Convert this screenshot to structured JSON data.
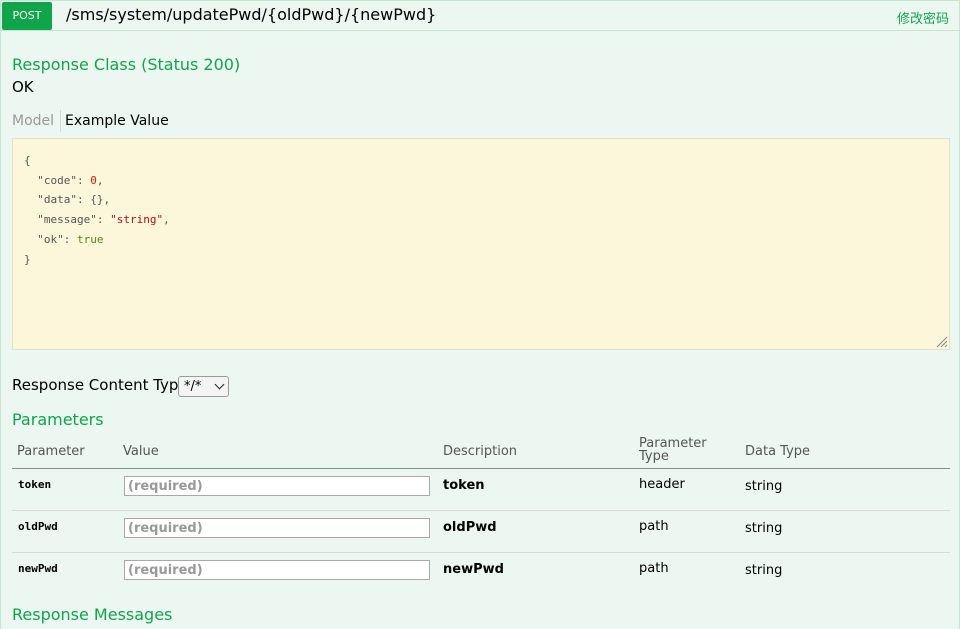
{
  "operation": {
    "method": "POST",
    "path": "/sms/system/updatePwd/{oldPwd}/{newPwd}",
    "summary": "修改密码"
  },
  "response_class": {
    "title": "Response Class (Status 200)",
    "status_text": "OK",
    "tabs": {
      "model": "Model",
      "example": "Example Value"
    },
    "example": {
      "open": "{",
      "close": "}",
      "fields": [
        {
          "key": "\"code\"",
          "value": "0",
          "kind": "number",
          "sep": ","
        },
        {
          "key": "\"data\"",
          "value": "{}",
          "kind": "plain",
          "sep": ","
        },
        {
          "key": "\"message\"",
          "value": "\"string\"",
          "kind": "string",
          "sep": ","
        },
        {
          "key": "\"ok\"",
          "value": "true",
          "kind": "boolean",
          "sep": ""
        }
      ]
    }
  },
  "response_content_type": {
    "label": "Response Content Type",
    "selected": "*/*"
  },
  "parameters": {
    "title": "Parameters",
    "headers": {
      "parameter": "Parameter",
      "value": "Value",
      "description": "Description",
      "parameter_type_line1": "Parameter",
      "parameter_type_line2": "Type",
      "data_type": "Data Type"
    },
    "rows": [
      {
        "name": "token",
        "placeholder": "(required)",
        "description": "token",
        "param_type": "header",
        "data_type": "string"
      },
      {
        "name": "oldPwd",
        "placeholder": "(required)",
        "description": "oldPwd",
        "param_type": "path",
        "data_type": "string"
      },
      {
        "name": "newPwd",
        "placeholder": "(required)",
        "description": "newPwd",
        "param_type": "path",
        "data_type": "string"
      }
    ]
  },
  "response_messages": {
    "title": "Response Messages"
  },
  "colors": {
    "accent": "#10a54a",
    "panel_bg": "#ebf7f0",
    "code_bg": "#fcf6db"
  }
}
